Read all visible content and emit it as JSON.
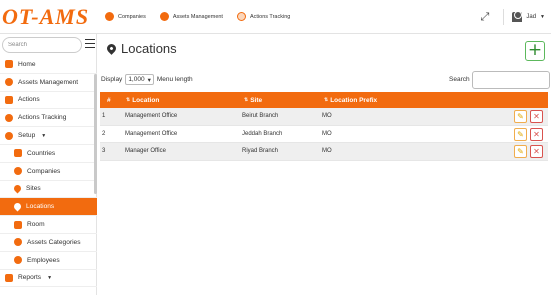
{
  "brand": "OT-AMS",
  "topnav": [
    {
      "label": "Companies",
      "icon": "rocket-icon"
    },
    {
      "label": "Assets Management",
      "icon": "rocket-icon"
    },
    {
      "label": "Actions Tracking",
      "icon": "history-icon"
    }
  ],
  "user": {
    "name": "Jad",
    "icon": "user-icon"
  },
  "sidebar": {
    "search_placeholder": "Search",
    "items": [
      {
        "label": "Home",
        "icon": "home-icon"
      },
      {
        "label": "Assets Management",
        "icon": "rocket-icon"
      },
      {
        "label": "Actions",
        "icon": "clipboard-icon"
      },
      {
        "label": "Actions Tracking",
        "icon": "history-icon"
      },
      {
        "label": "Setup",
        "icon": "gear-icon"
      },
      {
        "label": "Countries",
        "icon": "flag-icon"
      },
      {
        "label": "Companies",
        "icon": "rocket-icon"
      },
      {
        "label": "Sites",
        "icon": "map-marker-icon"
      },
      {
        "label": "Locations",
        "icon": "map-marker-icon"
      },
      {
        "label": "Room",
        "icon": "door-icon"
      },
      {
        "label": "Assets Categories",
        "icon": "rocket-icon"
      },
      {
        "label": "Employees",
        "icon": "users-icon"
      },
      {
        "label": "Reports",
        "icon": "chart-icon"
      }
    ]
  },
  "page": {
    "title": "Locations",
    "add_label": "+",
    "display_label": "Display",
    "length_value": "1,000",
    "menu_length_label": "Menu length",
    "search_label": "Search"
  },
  "table": {
    "columns": [
      "#",
      "Location",
      "Site",
      "Location Prefix"
    ],
    "rows": [
      {
        "num": "1",
        "location": "Management Office",
        "site": "Beirut Branch",
        "prefix": "MO"
      },
      {
        "num": "2",
        "location": "Management Office",
        "site": "Jeddah Branch",
        "prefix": "MO"
      },
      {
        "num": "3",
        "location": "Manager Office",
        "site": "Riyad Branch",
        "prefix": "MO"
      }
    ],
    "edit_glyph": "✎",
    "delete_glyph": "✕"
  },
  "colors": {
    "accent": "#f26b0f",
    "add": "#5cb85c",
    "edit": "#f0ad4e",
    "delete": "#d9534f"
  }
}
